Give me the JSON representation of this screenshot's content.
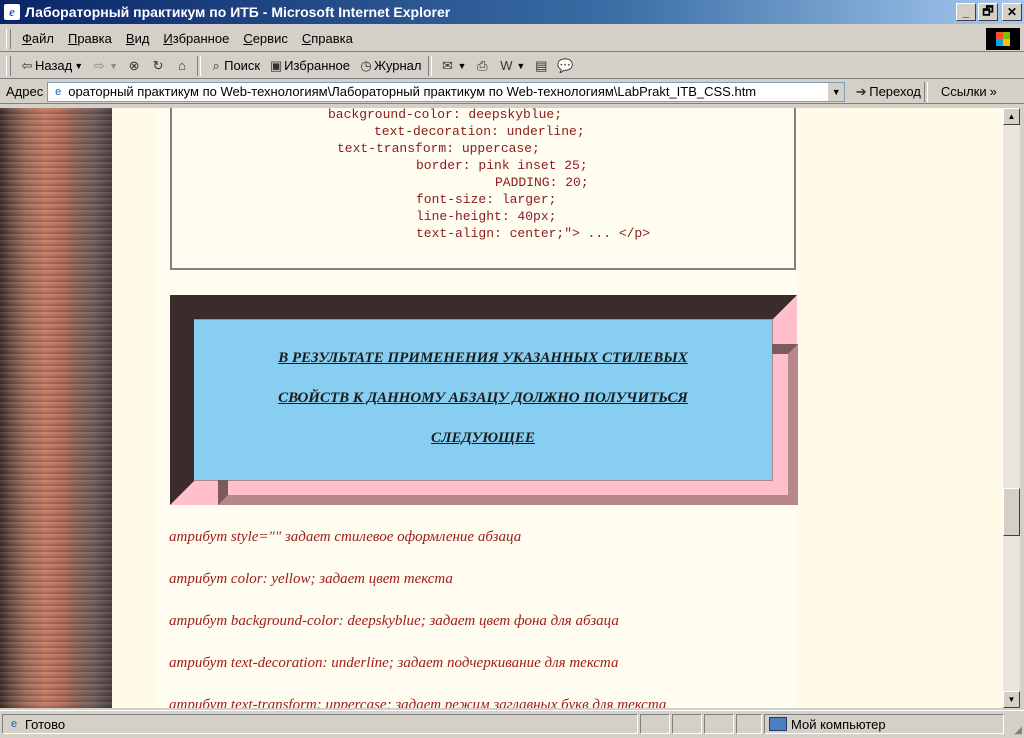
{
  "window": {
    "title": "Лабораторный практикум по ИТБ - Microsoft Internet Explorer",
    "minimize": "_",
    "maximize": "🗗",
    "close": "✕"
  },
  "menu": [
    "Файл",
    "Правка",
    "Вид",
    "Избранное",
    "Сервис",
    "Справка"
  ],
  "toolbar": {
    "back": "Назад",
    "search": "Поиск",
    "favorites": "Избранное",
    "history": "Журнал"
  },
  "address": {
    "label": "Адрес",
    "url": "ораторный практикум по Web-технологиям\\Лабораторный практикум по Web-технологиям\\LabPrakt_ITB_CSS.htm",
    "go": "Переход",
    "links": "Ссылки"
  },
  "code": {
    "lines": [
      "background-color: deepskyblue;",
      "text-decoration: underline;",
      "text-transform: uppercase;",
      "border: pink inset 25;",
      "PADDING: 20;",
      "font-size: larger;",
      "line-height: 40px;",
      "text-align: center;\"> ... </p>"
    ]
  },
  "result": {
    "lines": [
      "В РЕЗУЛЬТАТЕ ПРИМЕНЕНИЯ УКАЗАННЫХ СТИЛЕВЫХ",
      "СВОЙСТВ К ДАННОМУ АБЗАЦУ ДОЛЖНО ПОЛУЧИТЬСЯ",
      "СЛЕДУЮЩЕЕ"
    ],
    "background_color": "#87cef0",
    "border_color": "#ffc0cb"
  },
  "descriptions": [
    "атрибут style=\"\" задает стилевое оформление абзаца",
    "атрибут color: yellow; задает цвет текста",
    "атрибут background-color: deepskyblue; задает цвет фона для абзаца",
    "атрибут text-decoration: underline; задает подчеркивание для текста",
    "атрибут text-transform: uppercase; задает режим заглавных букв для текста"
  ],
  "status": {
    "text": "Готово",
    "zone": "Мой компьютер"
  },
  "icons": {
    "app": "ie-icon",
    "page": "page-icon"
  }
}
